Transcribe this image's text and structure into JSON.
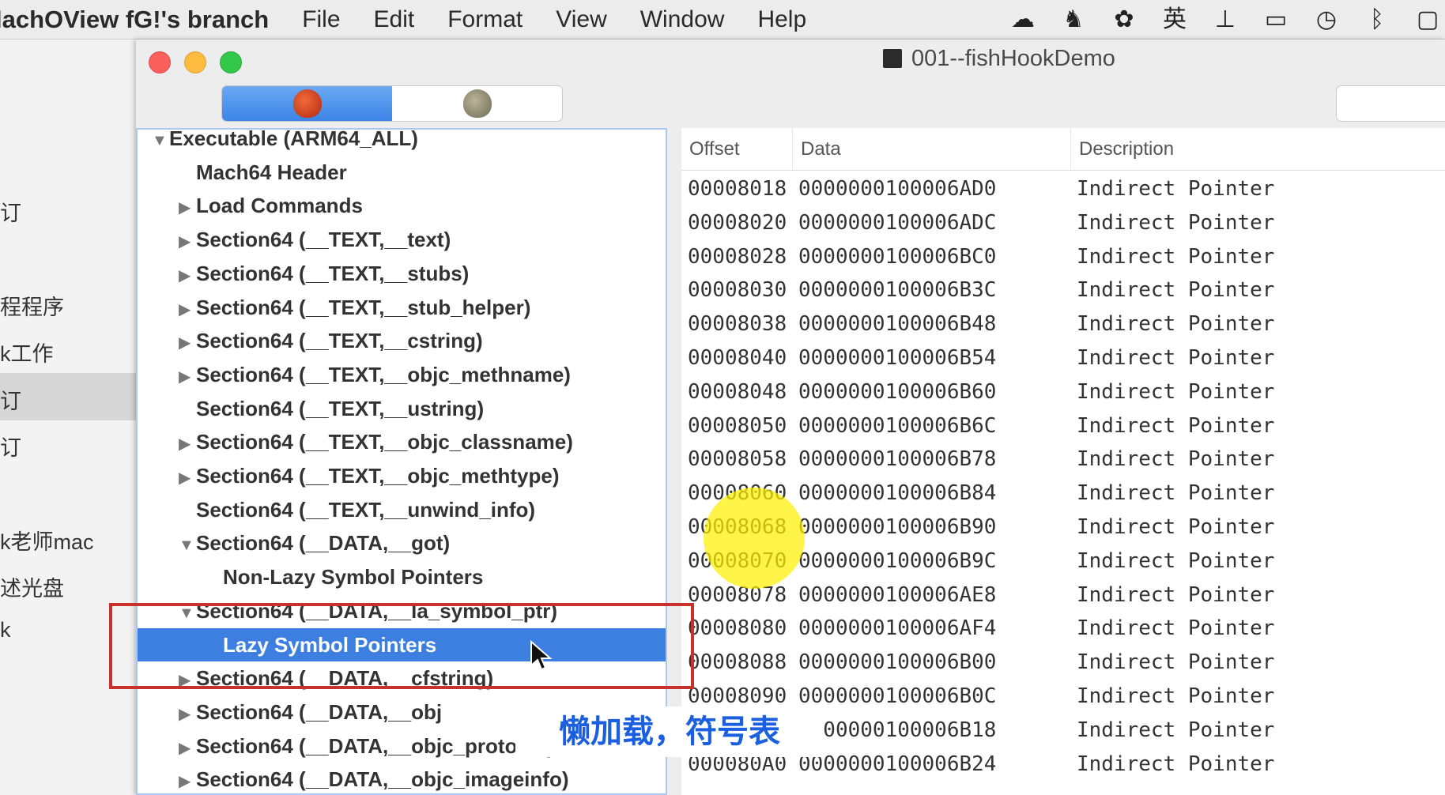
{
  "menubar": {
    "app_name": "lachOView fG!'s branch",
    "menus": [
      "File",
      "Edit",
      "Format",
      "View",
      "Window",
      "Help"
    ]
  },
  "background_sidebar": {
    "fragments": [
      "订",
      "程程序",
      "k工作",
      "订",
      "订",
      "k老师mac",
      "述光盘",
      "k"
    ]
  },
  "window": {
    "title": "001--fishHookDemo"
  },
  "outline": {
    "items": [
      {
        "label": "Executable  (ARM64_ALL)",
        "toggle": "▼",
        "selected": false
      },
      {
        "label": "Mach64 Header",
        "toggle": "",
        "selected": false
      },
      {
        "label": "Load Commands",
        "toggle": "▶",
        "selected": false
      },
      {
        "label": "Section64 (__TEXT,__text)",
        "toggle": "▶",
        "selected": false
      },
      {
        "label": "Section64 (__TEXT,__stubs)",
        "toggle": "▶",
        "selected": false
      },
      {
        "label": "Section64 (__TEXT,__stub_helper)",
        "toggle": "▶",
        "selected": false
      },
      {
        "label": "Section64 (__TEXT,__cstring)",
        "toggle": "▶",
        "selected": false
      },
      {
        "label": "Section64 (__TEXT,__objc_methname)",
        "toggle": "▶",
        "selected": false
      },
      {
        "label": "Section64 (__TEXT,__ustring)",
        "toggle": "",
        "selected": false
      },
      {
        "label": "Section64 (__TEXT,__objc_classname)",
        "toggle": "▶",
        "selected": false
      },
      {
        "label": "Section64 (__TEXT,__objc_methtype)",
        "toggle": "▶",
        "selected": false
      },
      {
        "label": "Section64 (__TEXT,__unwind_info)",
        "toggle": "",
        "selected": false
      },
      {
        "label": "Section64 (__DATA,__got)",
        "toggle": "▼",
        "selected": false
      },
      {
        "label": "Non-Lazy Symbol Pointers",
        "toggle": "",
        "selected": false
      },
      {
        "label": "Section64 (__DATA,__la_symbol_ptr)",
        "toggle": "▼",
        "selected": false
      },
      {
        "label": "Lazy Symbol Pointers",
        "toggle": "",
        "selected": true
      },
      {
        "label": "Section64 (__DATA,__cfstring)",
        "toggle": "▶",
        "selected": false
      },
      {
        "label": "Section64 (__DATA,__obj",
        "toggle": "▶",
        "selected": false
      },
      {
        "label": "Section64 (__DATA,__objc_protolist)",
        "toggle": "▶",
        "selected": false
      },
      {
        "label": "Section64 (__DATA,__objc_imageinfo)",
        "toggle": "▶",
        "selected": false
      }
    ]
  },
  "table": {
    "headers": [
      "Offset",
      "Data",
      "Description"
    ],
    "rows": [
      [
        "00008018",
        "0000000100006AD0",
        "Indirect Pointer"
      ],
      [
        "00008020",
        "0000000100006ADC",
        "Indirect Pointer"
      ],
      [
        "00008028",
        "0000000100006BC0",
        "Indirect Pointer"
      ],
      [
        "00008030",
        "0000000100006B3C",
        "Indirect Pointer"
      ],
      [
        "00008038",
        "0000000100006B48",
        "Indirect Pointer"
      ],
      [
        "00008040",
        "0000000100006B54",
        "Indirect Pointer"
      ],
      [
        "00008048",
        "0000000100006B60",
        "Indirect Pointer"
      ],
      [
        "00008050",
        "0000000100006B6C",
        "Indirect Pointer"
      ],
      [
        "00008058",
        "0000000100006B78",
        "Indirect Pointer"
      ],
      [
        "00008060",
        "0000000100006B84",
        "Indirect Pointer"
      ],
      [
        "00008068",
        "0000000100006B90",
        "Indirect Pointer"
      ],
      [
        "00008070",
        "0000000100006B9C",
        "Indirect Pointer"
      ],
      [
        "00008078",
        "0000000100006AE8",
        "Indirect Pointer"
      ],
      [
        "00008080",
        "0000000100006AF4",
        "Indirect Pointer"
      ],
      [
        "00008088",
        "0000000100006B00",
        "Indirect Pointer"
      ],
      [
        "00008090",
        "0000000100006B0C",
        "Indirect Pointer"
      ],
      [
        "",
        "0000000100006B18",
        "Indirect Pointer"
      ],
      [
        "000080A0",
        "0000000100006B24",
        "Indirect Pointer"
      ]
    ]
  },
  "caption": "懒加载，符号表",
  "colors": {
    "selection": "#3d7fe1",
    "annotation_box": "#c8322a",
    "highlight_circle": "#fff000",
    "caption_text": "#1a5fe0"
  }
}
